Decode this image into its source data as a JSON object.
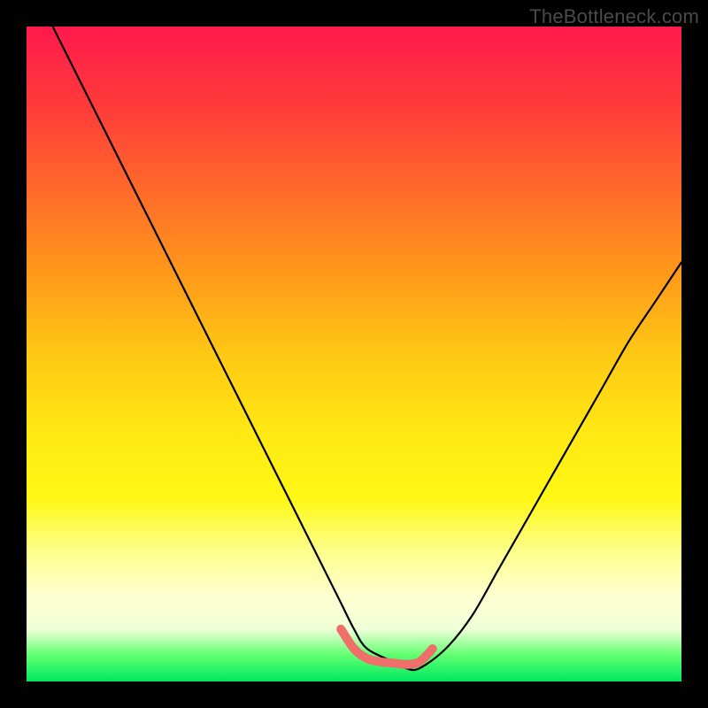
{
  "watermark": "TheBottleneck.com",
  "chart_data": {
    "type": "line",
    "title": "",
    "xlabel": "",
    "ylabel": "",
    "xlim": [
      0,
      100
    ],
    "ylim": [
      0,
      100
    ],
    "curve_main": {
      "name": "bottleneck-curve",
      "color": "#000000",
      "x": [
        4,
        8,
        12,
        16,
        20,
        24,
        28,
        32,
        36,
        40,
        44,
        48,
        50,
        52,
        56,
        58,
        60,
        64,
        68,
        72,
        76,
        80,
        84,
        88,
        92,
        96,
        100
      ],
      "y": [
        100,
        92,
        84,
        76,
        68,
        60,
        52,
        44,
        36,
        28,
        20,
        12,
        8,
        5,
        3,
        2,
        2,
        5,
        10,
        17,
        24,
        31,
        38,
        45,
        52,
        58,
        64
      ]
    },
    "highlight_band": {
      "name": "optimal-range",
      "color": "#ef6f6a",
      "x": [
        48,
        50,
        52,
        54,
        56,
        58,
        60,
        62
      ],
      "y": [
        8,
        5,
        3.5,
        3,
        2.8,
        2.6,
        3,
        5
      ]
    },
    "legend": [],
    "grid": false
  }
}
